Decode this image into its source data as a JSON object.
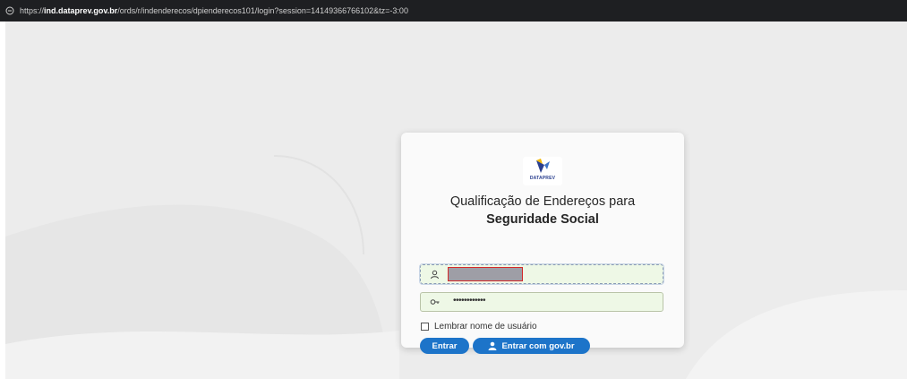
{
  "browser": {
    "url_scheme": "https://",
    "url_host": "ind.dataprev.gov.br",
    "url_path": "/ords/r/indenderecos/dpienderecos101/login?session=14149366766102&tz=-3:00"
  },
  "logo": {
    "brand": "DATAPREV",
    "icon": "dataprev-logo"
  },
  "login": {
    "title_line1": "Qualificação de Endereços para",
    "title_line2": "Seguridade Social",
    "username_icon": "user-icon",
    "password_icon": "key-icon",
    "password_mask": "••••••••••••",
    "remember_label": "Lembrar nome de usuário",
    "remember_checked": false,
    "submit_label": "Entrar",
    "govbr_label": "Entrar com gov.br",
    "govbr_icon": "person-icon"
  },
  "colors": {
    "button": "#1d74c9",
    "field_background": "#eef8e6",
    "redaction_border": "#d42a2a",
    "brand_blue": "#2a3f8f",
    "brand_yellow": "#f2b705"
  }
}
